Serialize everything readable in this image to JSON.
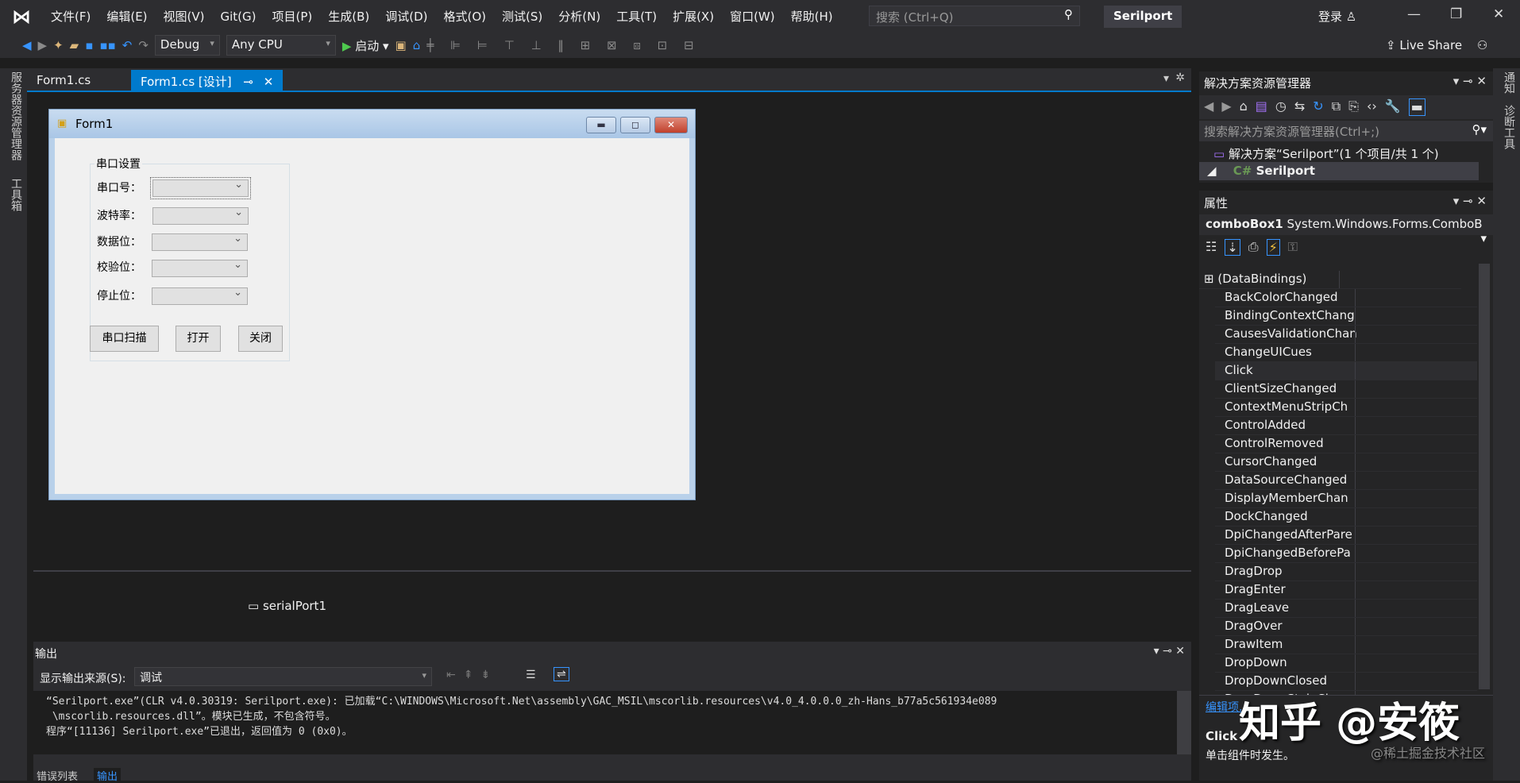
{
  "menubar": {
    "items": [
      "文件(F)",
      "编辑(E)",
      "视图(V)",
      "Git(G)",
      "项目(P)",
      "生成(B)",
      "调试(D)",
      "格式(O)",
      "测试(S)",
      "分析(N)",
      "工具(T)",
      "扩展(X)",
      "窗口(W)",
      "帮助(H)"
    ],
    "search_placeholder": "搜索 (Ctrl+Q)",
    "solution_name": "Serilport",
    "login": "登录"
  },
  "toolbar": {
    "config": "Debug",
    "platform": "Any CPU",
    "start": "启动",
    "live_share": "Live Share"
  },
  "side_tabs": {
    "left": [
      "服务器资源管理器",
      "工具箱"
    ],
    "right": [
      "通知",
      "诊断工具"
    ]
  },
  "doc_tabs": [
    {
      "label": "Form1.cs"
    },
    {
      "label": "Form1.cs [设计]"
    }
  ],
  "form": {
    "title": "Form1",
    "group_title": "串口设置",
    "fields": [
      {
        "label": "串口号："
      },
      {
        "label": "波特率："
      },
      {
        "label": "数据位："
      },
      {
        "label": "校验位："
      },
      {
        "label": "停止位："
      }
    ],
    "buttons": [
      "串口扫描",
      "打开",
      "关闭"
    ]
  },
  "tray": {
    "component": "serialPort1"
  },
  "output": {
    "title": "输出",
    "source_label": "显示输出来源(S):",
    "source_value": "调试",
    "lines": [
      "“Serilport.exe”(CLR v4.0.30319: Serilport.exe): 已加载“C:\\WINDOWS\\Microsoft.Net\\assembly\\GAC_MSIL\\mscorlib.resources\\v4.0_4.0.0.0_zh-Hans_b77a5c561934e089",
      " \\mscorlib.resources.dll”。模块已生成，不包含符号。",
      "程序“[11136] Serilport.exe”已退出，返回值为 0 (0x0)。"
    ]
  },
  "bottom_tabs": [
    "错误列表",
    "输出"
  ],
  "solution_explorer": {
    "title": "解决方案资源管理器",
    "search_placeholder": "搜索解决方案资源管理器(Ctrl+;)",
    "solution": "解决方案“Serilport”(1 个项目/共 1 个)",
    "project": "Serilport"
  },
  "properties": {
    "title": "属性",
    "object": "comboBox1",
    "type": "System.Windows.Forms.ComboB",
    "rows": [
      "(DataBindings)",
      "BackColorChanged",
      "BindingContextChang",
      "CausesValidationChan",
      "ChangeUICues",
      "Click",
      "ClientSizeChanged",
      "ContextMenuStripCh",
      "ControlAdded",
      "ControlRemoved",
      "CursorChanged",
      "DataSourceChanged",
      "DisplayMemberChan",
      "DockChanged",
      "DpiChangedAfterPare",
      "DpiChangedBeforePa",
      "DragDrop",
      "DragEnter",
      "DragLeave",
      "DragOver",
      "DrawItem",
      "DropDown",
      "DropDownClosed",
      "DropDownStyleChang"
    ],
    "edit_items_link": "编辑项...",
    "desc_title": "Click",
    "desc_text": "单击组件时发生。"
  },
  "watermark": {
    "main": "知乎 @安筱",
    "sub": "@稀土掘金技术社区"
  }
}
